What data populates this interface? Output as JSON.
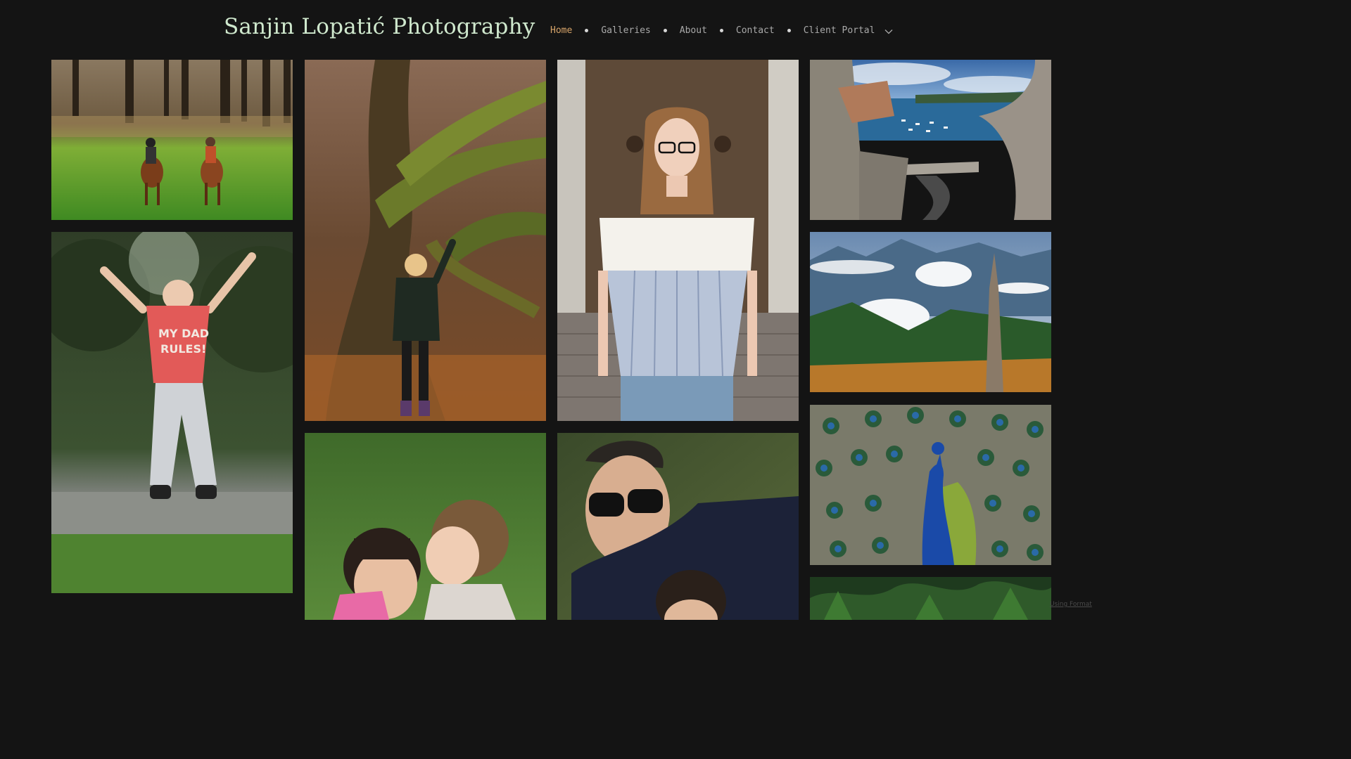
{
  "site": {
    "title": "Sanjin Lopatić Photography"
  },
  "nav": {
    "items": [
      {
        "label": "Home",
        "active": true
      },
      {
        "label": "Galleries",
        "active": false
      },
      {
        "label": "About",
        "active": false
      },
      {
        "label": "Contact",
        "active": false
      },
      {
        "label": "Client Portal",
        "active": false
      }
    ],
    "dropdown_icon": "chevron-down-icon"
  },
  "gallery": {
    "photos": [
      {
        "subject": "horse-riders-meadow"
      },
      {
        "subject": "boy-jumping-park"
      },
      {
        "subject": "woman-mossy-tree"
      },
      {
        "subject": "mother-daughter-kiss"
      },
      {
        "subject": "woman-portrait-door"
      },
      {
        "subject": "couple-sunglasses"
      },
      {
        "subject": "dubrovnik-walls-harbor"
      },
      {
        "subject": "mountain-valley-clouds"
      },
      {
        "subject": "peacock-feathers"
      },
      {
        "subject": "forest-ferns"
      }
    ]
  },
  "footer": {
    "credit": "Using Format"
  },
  "colors": {
    "background": "#141414",
    "title": "#cfe8cd",
    "nav_active": "#d7a46a",
    "nav_text": "#a9a9a9"
  }
}
